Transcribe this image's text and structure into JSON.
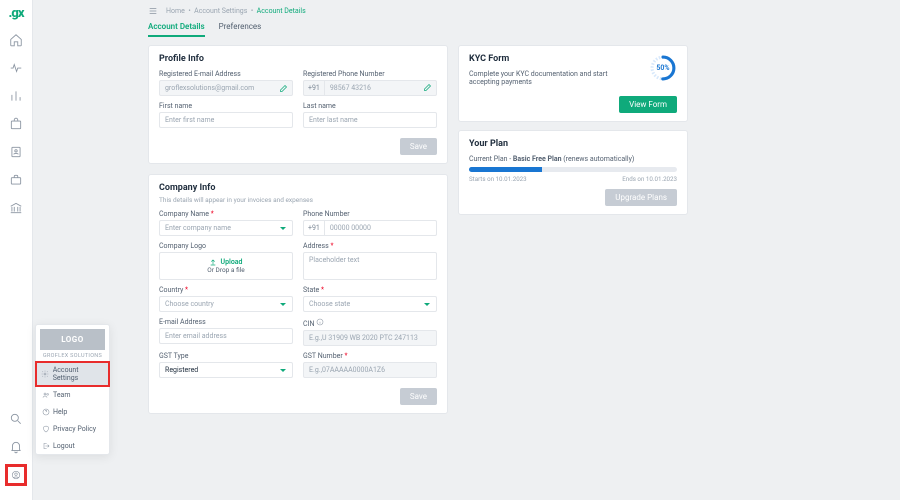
{
  "logo_text": ".gx",
  "breadcrumb": {
    "home": "Home",
    "account_settings": "Account Settings",
    "account_details": "Account Details"
  },
  "tabs": {
    "details": "Account Details",
    "prefs": "Preferences"
  },
  "profile": {
    "title": "Profile Info",
    "email_label": "Registered E-mail Address",
    "email_placeholder": "groflexsolutions@gmail.com",
    "phone_label": "Registered Phone Number",
    "phone_prefix": "+91",
    "phone_placeholder": "98567 43216",
    "first_label": "First name",
    "first_ph": "Enter first name",
    "last_label": "Last name",
    "last_ph": "Enter last name",
    "save": "Save"
  },
  "company": {
    "title": "Company Info",
    "subtitle": "This details will appear in your invoices and expenses",
    "name_label": "Company Name",
    "name_ph": "Enter company name",
    "phone_label": "Phone Number",
    "phone_prefix": "+91",
    "phone_ph": "00000 00000",
    "logo_label": "Company Logo",
    "upload_label": "Upload",
    "upload_hint": "Or Drop a file",
    "addr_label": "Address",
    "addr_ph": "Placeholder text",
    "country_label": "Country",
    "country_ph": "Choose country",
    "state_label": "State",
    "state_ph": "Choose state",
    "email_label": "E-mail Address",
    "email_ph": "Enter email address",
    "cin_label": "CIN",
    "cin_ph": "E.g.,U 31909 WB 2020 PTC 247113",
    "gst_type_label": "GST Type",
    "gst_type_value": "Registered",
    "gst_no_label": "GST Number",
    "gst_no_ph": "E.g.,07AAAAA0000A1Z6",
    "save": "Save"
  },
  "kyc": {
    "title": "KYC Form",
    "desc": "Complete your KYC documentation and start accepting payments",
    "pct": "50%",
    "button": "View Form"
  },
  "plan": {
    "title": "Your Plan",
    "current_label": "Current Plan - ",
    "plan_name": "Basic Free Plan",
    "renew": " (renews automatically)",
    "start_label": "Starts on ",
    "start": "10.01.2023",
    "end_label": "Ends on ",
    "end": "10.01.2023",
    "button": "Upgrade Plans"
  },
  "float": {
    "logo": "LOGO",
    "company": "GROFLEX SOLUTIONS",
    "items": [
      "Account Settings",
      "Team",
      "Help",
      "Privacy Policy",
      "Logout"
    ]
  },
  "icons": {
    "home": "home-icon",
    "pulse": "pulse-icon",
    "bars": "analytics-icon",
    "box": "product-icon",
    "contact": "contacts-icon",
    "brief": "briefcase-icon",
    "bank": "bank-icon",
    "search": "search-icon",
    "bell": "bell-icon",
    "user": "user-icon"
  }
}
